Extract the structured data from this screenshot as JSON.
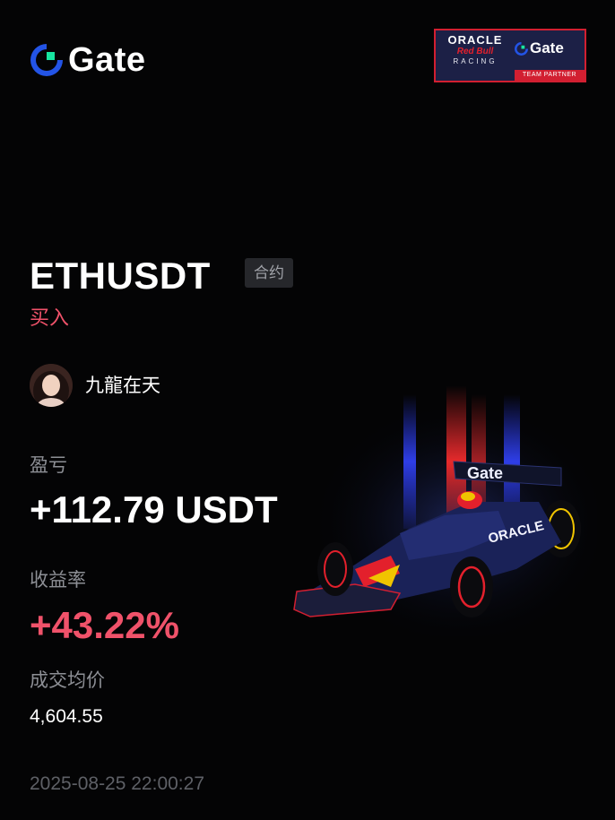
{
  "brand": {
    "name": "Gate",
    "logo_icon": "gate-logo-icon"
  },
  "partner_badge": {
    "oracle": "ORACLE",
    "red_bull": "Red Bull",
    "racing": "RACING",
    "gate": "Gate",
    "partner": "TEAM PARTNER"
  },
  "trade": {
    "symbol": "ETHUSDT",
    "type_tag": "合约",
    "side": "买入"
  },
  "user": {
    "name": "九龍在天"
  },
  "stats": {
    "pnl_label": "盈亏",
    "pnl_value": "+112.79 USDT",
    "roi_label": "收益率",
    "roi_value": "+43.22%",
    "avg_price_label": "成交均价",
    "avg_price_value": "4,604.55"
  },
  "timestamp": "2025-08-25 22:00:27",
  "colors": {
    "background": "#040405",
    "accent_red": "#f0526a",
    "gate_blue": "#2354e6",
    "gate_green": "#17e6a1",
    "muted": "#8d8f95"
  }
}
